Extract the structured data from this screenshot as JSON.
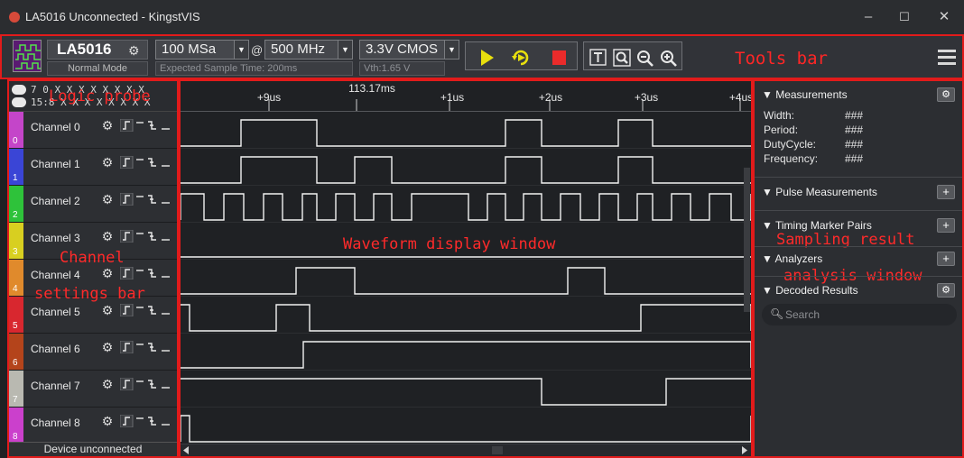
{
  "window": {
    "title": "LA5016 Unconnected - KingstVIS",
    "controls": [
      "–",
      "☐",
      "✕"
    ]
  },
  "toolbar": {
    "device_name": "LA5016",
    "device_mode": "Normal Mode",
    "sample_rate": "100 MSa",
    "at_symbol": "@",
    "frequency": "500 MHz",
    "logic_level": "3.3V CMOS",
    "expected_time": "Expected Sample Time: 200ms",
    "vth": "Vth:1.65 V",
    "annotation": "Tools bar",
    "icons": [
      "play-icon",
      "repeat-run-icon",
      "stop-icon",
      "text-marker-icon",
      "zoom-fit-icon",
      "zoom-out-icon",
      "zoom-in-icon",
      "menu-icon"
    ]
  },
  "probe": {
    "row1": "7 0 X X X X X X X X",
    "row2": "15:8 X X X X X X X X",
    "annotation": "Logic probe"
  },
  "channels": [
    {
      "name": "Channel 0",
      "index": "0",
      "color": "#c445c9"
    },
    {
      "name": "Channel 1",
      "index": "1",
      "color": "#3a45d6"
    },
    {
      "name": "Channel 2",
      "index": "2",
      "color": "#2ec23a"
    },
    {
      "name": "Channel 3",
      "index": "3",
      "color": "#d8cf20"
    },
    {
      "name": "Channel 4",
      "index": "4",
      "color": "#e08a2c"
    },
    {
      "name": "Channel 5",
      "index": "5",
      "color": "#d8272f"
    },
    {
      "name": "Channel 6",
      "index": "6",
      "color": "#b4441b"
    },
    {
      "name": "Channel 7",
      "index": "7",
      "color": "#b9b9b1"
    },
    {
      "name": "Channel 8",
      "index": "8",
      "color": "#cb40cc"
    }
  ],
  "channel_annotation": [
    "Channel",
    "settings bar"
  ],
  "status": "Device unconnected",
  "waveform": {
    "annotation": "Waveform display window",
    "time_labels": [
      "+9us",
      "113.17ms",
      "+1us",
      "+2us",
      "+3us",
      "+4us"
    ]
  },
  "right": {
    "measurements_title": "▼ Measurements",
    "measurements": [
      {
        "label": "Width:",
        "value": "###"
      },
      {
        "label": "Period:",
        "value": "###"
      },
      {
        "label": "DutyCycle:",
        "value": "###"
      },
      {
        "label": "Frequency:",
        "value": "###"
      }
    ],
    "pulse_title": "▼ Pulse Measurements",
    "timing_title": "▼ Timing Marker Pairs",
    "analyzers_title": "▼ Analyzers",
    "decoded_title": "▼ Decoded Results",
    "add_label": "+",
    "search_placeholder": "Search",
    "annotation1": "Sampling result",
    "annotation2": "analysis window"
  }
}
